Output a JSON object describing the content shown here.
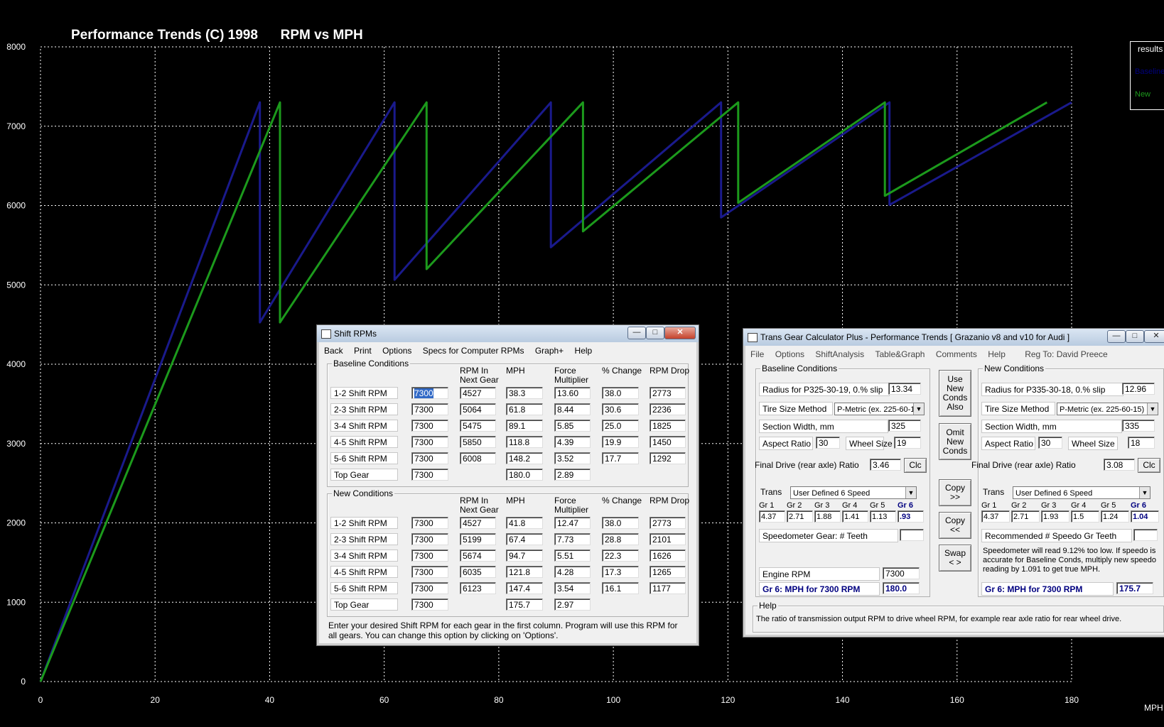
{
  "chart_data": {
    "type": "line",
    "title": "Performance Trends (C) 1998      RPM vs MPH",
    "xlabel": "MPH",
    "ylabel": "",
    "xlim": [
      0,
      180
    ],
    "ylim": [
      0,
      8000
    ],
    "x_ticks": [
      0,
      20,
      40,
      60,
      80,
      100,
      120,
      140,
      160,
      180
    ],
    "y_ticks": [
      0,
      1000,
      2000,
      3000,
      4000,
      5000,
      6000,
      7000,
      8000
    ],
    "grid": true,
    "legend_title": "results",
    "series": [
      {
        "name": "Baseline",
        "color": "#1a1a8c",
        "points": [
          [
            0,
            0
          ],
          [
            38.3,
            7300
          ],
          [
            38.3,
            4527
          ],
          [
            61.8,
            7300
          ],
          [
            61.8,
            5064
          ],
          [
            89.1,
            7300
          ],
          [
            89.1,
            5475
          ],
          [
            118.8,
            7300
          ],
          [
            118.8,
            5850
          ],
          [
            148.2,
            7300
          ],
          [
            148.2,
            6008
          ],
          [
            180.0,
            7300
          ]
        ]
      },
      {
        "name": "New",
        "color": "#1c9a1c",
        "points": [
          [
            0,
            0
          ],
          [
            41.8,
            7300
          ],
          [
            41.8,
            4527
          ],
          [
            67.4,
            7300
          ],
          [
            67.4,
            5199
          ],
          [
            94.7,
            7300
          ],
          [
            94.7,
            5674
          ],
          [
            121.8,
            7300
          ],
          [
            121.8,
            6035
          ],
          [
            147.4,
            7300
          ],
          [
            147.4,
            6123
          ],
          [
            175.7,
            7300
          ]
        ]
      }
    ]
  },
  "shift": {
    "title": "Shift RPMs",
    "menu": [
      "Back",
      "Print",
      "Options",
      "Specs for Computer RPMs",
      "Graph+",
      "Help"
    ],
    "baseline_title": "Baseline Conditions",
    "new_title": "New Conditions",
    "headers": {
      "rpm_next": "RPM In\nNext Gear",
      "mph": "MPH",
      "force": "Force\nMultiplier",
      "pct": "% Change",
      "drop": "RPM Drop"
    },
    "baseline_rows": [
      {
        "label": "1-2 Shift RPM",
        "rpm": "7300",
        "next": "4527",
        "mph": "38.3",
        "force": "13.60",
        "pct": "38.0",
        "drop": "2773"
      },
      {
        "label": "2-3 Shift RPM",
        "rpm": "7300",
        "next": "5064",
        "mph": "61.8",
        "force": "8.44",
        "pct": "30.6",
        "drop": "2236"
      },
      {
        "label": "3-4 Shift RPM",
        "rpm": "7300",
        "next": "5475",
        "mph": "89.1",
        "force": "5.85",
        "pct": "25.0",
        "drop": "1825"
      },
      {
        "label": "4-5 Shift RPM",
        "rpm": "7300",
        "next": "5850",
        "mph": "118.8",
        "force": "4.39",
        "pct": "19.9",
        "drop": "1450"
      },
      {
        "label": "5-6 Shift RPM",
        "rpm": "7300",
        "next": "6008",
        "mph": "148.2",
        "force": "3.52",
        "pct": "17.7",
        "drop": "1292"
      },
      {
        "label": "Top Gear",
        "rpm": "7300",
        "next": "",
        "mph": "180.0",
        "force": "2.89",
        "pct": "",
        "drop": ""
      }
    ],
    "new_rows": [
      {
        "label": "1-2 Shift RPM",
        "rpm": "7300",
        "next": "4527",
        "mph": "41.8",
        "force": "12.47",
        "pct": "38.0",
        "drop": "2773"
      },
      {
        "label": "2-3 Shift RPM",
        "rpm": "7300",
        "next": "5199",
        "mph": "67.4",
        "force": "7.73",
        "pct": "28.8",
        "drop": "2101"
      },
      {
        "label": "3-4 Shift RPM",
        "rpm": "7300",
        "next": "5674",
        "mph": "94.7",
        "force": "5.51",
        "pct": "22.3",
        "drop": "1626"
      },
      {
        "label": "4-5 Shift RPM",
        "rpm": "7300",
        "next": "6035",
        "mph": "121.8",
        "force": "4.28",
        "pct": "17.3",
        "drop": "1265"
      },
      {
        "label": "5-6 Shift RPM",
        "rpm": "7300",
        "next": "6123",
        "mph": "147.4",
        "force": "3.54",
        "pct": "16.1",
        "drop": "1177"
      },
      {
        "label": "Top Gear",
        "rpm": "7300",
        "next": "",
        "mph": "175.7",
        "force": "2.97",
        "pct": "",
        "drop": ""
      }
    ],
    "footer": "Enter your desired Shift RPM for each gear in the first column.  Program will use this RPM for all gears.  You can change this option by clicking on 'Options'."
  },
  "trans": {
    "title": "Trans Gear Calculator Plus - Performance Trends   [ Grazanio v8 and v10 for Audi ]",
    "menu": [
      "File",
      "Options",
      "ShiftAnalysis",
      "Table&Graph",
      "Comments",
      "Help",
      "Reg To: David Preece"
    ],
    "baseline": {
      "title": "Baseline Conditions",
      "radius_label": "Radius for P325-30-19, 0.% slip",
      "radius": "13.34",
      "tire_method_label": "Tire Size Method",
      "tire_method": "P-Metric (ex. 225-60-15)",
      "section_label": "Section Width, mm",
      "section": "325",
      "aspect_label": "Aspect Ratio",
      "aspect": "30",
      "wheel_label": "Wheel Size",
      "wheel": "19",
      "final_label": "Final Drive (rear axle) Ratio",
      "final": "3.46",
      "clc": "Clc",
      "trans_label": "Trans",
      "trans": "User Defined 6 Speed",
      "gear_labels": [
        "Gr 1",
        "Gr 2",
        "Gr 3",
        "Gr 4",
        "Gr 5",
        "Gr 6"
      ],
      "gears": [
        "4.37",
        "2.71",
        "1.88",
        "1.41",
        "1.13",
        ".93"
      ],
      "speedo_label": "Speedometer Gear: # Teeth",
      "speedo": "",
      "engine_label": "Engine RPM",
      "engine": "7300",
      "mph_label": "Gr 6: MPH for 7300 RPM",
      "mph": "180.0"
    },
    "new": {
      "title": "New Conditions",
      "radius_label": "Radius for P335-30-18, 0.% slip",
      "radius": "12.96",
      "tire_method_label": "Tire Size Method",
      "tire_method": "P-Metric (ex. 225-60-15)",
      "section_label": "Section Width, mm",
      "section": "335",
      "aspect_label": "Aspect Ratio",
      "aspect": "30",
      "wheel_label": "Wheel Size",
      "wheel": "18",
      "final_label": "Final Drive (rear axle) Ratio",
      "final": "3.08",
      "clc": "Clc",
      "trans_label": "Trans",
      "trans": "User Defined 6 Speed",
      "gear_labels": [
        "Gr 1",
        "Gr 2",
        "Gr 3",
        "Gr 4",
        "Gr 5",
        "Gr 6"
      ],
      "gears": [
        "4.37",
        "2.71",
        "1.93",
        "1.5",
        "1.24",
        "1.04"
      ],
      "speedo_label": "Recommended # Speedo Gr Teeth",
      "speedo": "",
      "note": "Speedometer will read 9.12% too low. If speedo is accurate for Baseline Conds, multiply new speedo reading by 1.091 to get true MPH.",
      "mph_label": "Gr 6: MPH for 7300 RPM",
      "mph": "175.7"
    },
    "buttons": {
      "use_new": "Use\nNew\nConds\nAlso",
      "omit_new": "Omit\nNew\nConds",
      "copy_right": "Copy\n>>",
      "copy_left": "Copy\n<<",
      "swap": "Swap\n< >"
    },
    "help_title": "Help",
    "help_text": "The ratio of transmission output RPM to drive wheel RPM, for example rear axle ratio for rear wheel drive."
  }
}
